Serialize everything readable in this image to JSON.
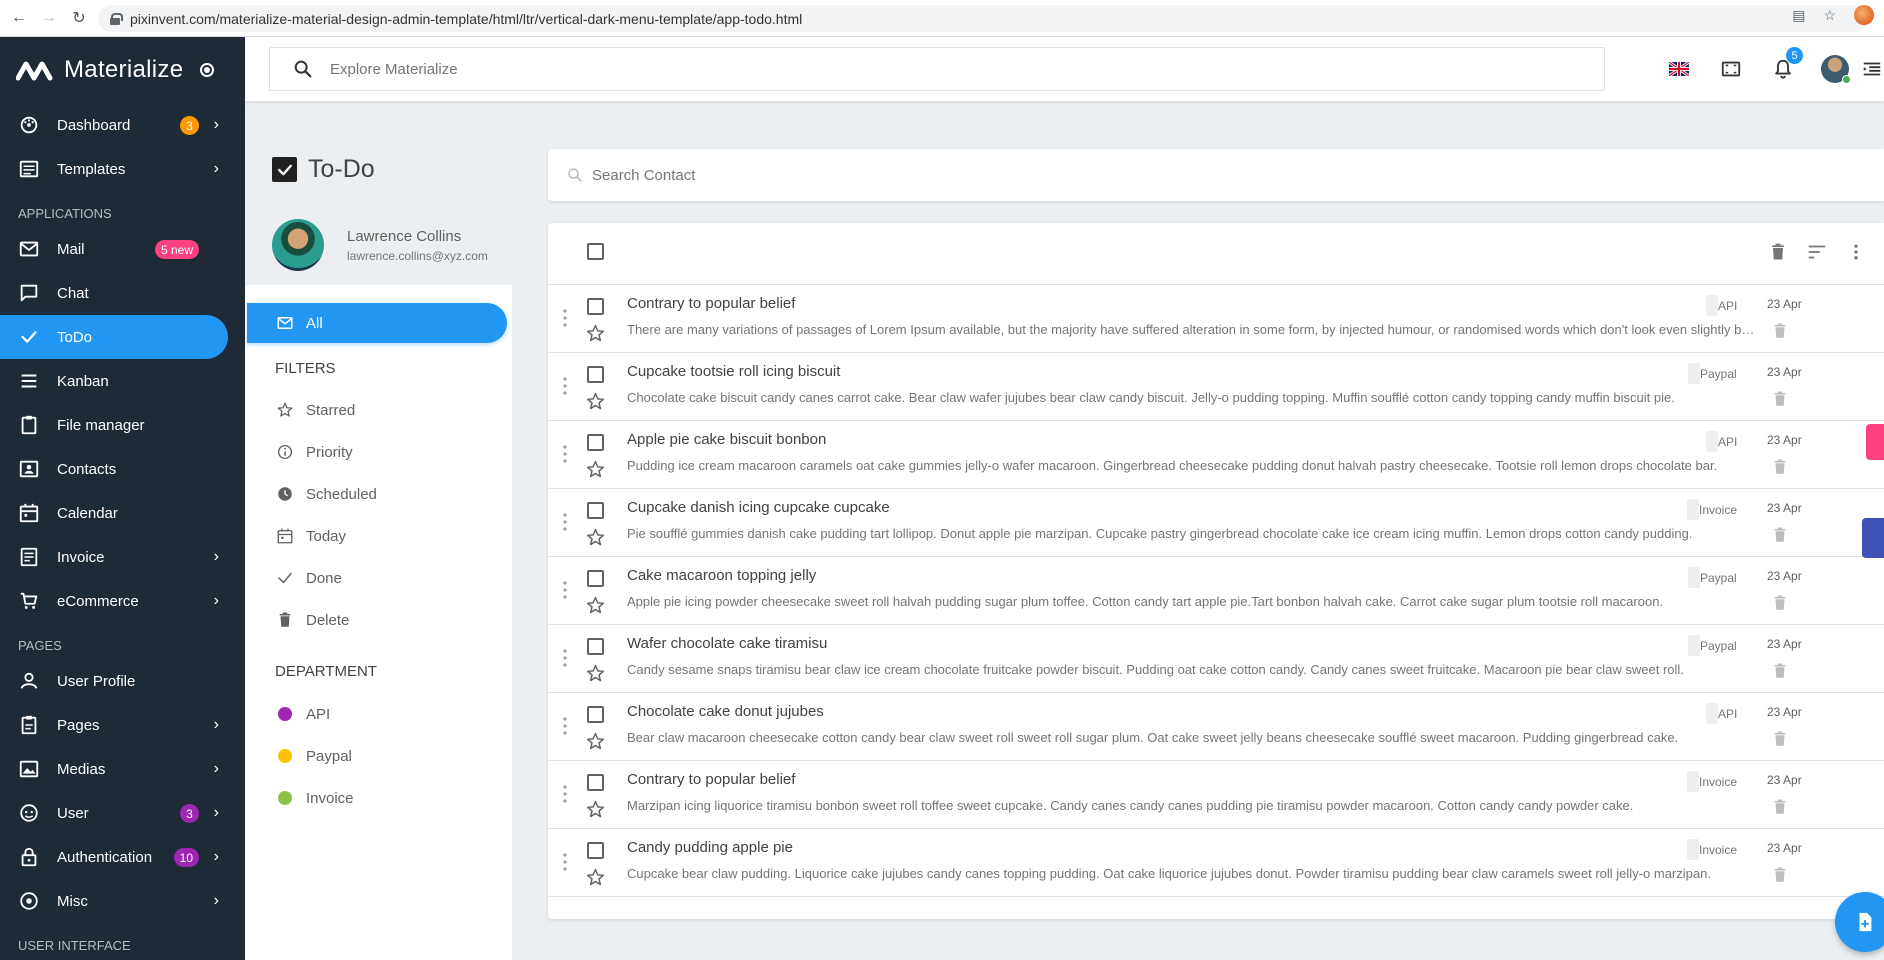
{
  "browser": {
    "url": "pixinvent.com/materialize-material-design-admin-template/html/ltr/vertical-dark-menu-template/app-todo.html"
  },
  "sidebar": {
    "brand": "Materialize",
    "items": [
      {
        "label": "Dashboard",
        "badge": "3",
        "badge_color": "#ff9800",
        "icon": "dashboard-icon",
        "chevron": true
      },
      {
        "label": "Templates",
        "icon": "templates-icon",
        "chevron": true
      }
    ],
    "applications_heading": "APPLICATIONS",
    "apps": [
      {
        "label": "Mail",
        "badge": "5 new",
        "badge_color": "#ff4081",
        "icon": "mail-icon"
      },
      {
        "label": "Chat",
        "icon": "chat-icon"
      },
      {
        "label": "ToDo",
        "icon": "check-icon",
        "active": true
      },
      {
        "label": "Kanban",
        "icon": "kanban-icon"
      },
      {
        "label": "File manager",
        "icon": "file-manager-icon"
      },
      {
        "label": "Contacts",
        "icon": "contacts-icon"
      },
      {
        "label": "Calendar",
        "icon": "calendar-icon"
      },
      {
        "label": "Invoice",
        "icon": "invoice-icon",
        "chevron": true
      },
      {
        "label": "eCommerce",
        "icon": "cart-icon",
        "chevron": true
      }
    ],
    "pages_heading": "PAGES",
    "pages": [
      {
        "label": "User Profile",
        "icon": "user-icon"
      },
      {
        "label": "Pages",
        "icon": "pages-icon",
        "chevron": true
      },
      {
        "label": "Medias",
        "icon": "media-icon",
        "chevron": true
      },
      {
        "label": "User",
        "badge": "3",
        "badge_color": "#9c27b0",
        "icon": "face-icon",
        "chevron": true
      },
      {
        "label": "Authentication",
        "badge": "10",
        "badge_color": "#9c27b0",
        "icon": "lock-icon",
        "chevron": true
      },
      {
        "label": "Misc",
        "icon": "misc-icon",
        "chevron": true
      }
    ],
    "ui_heading": "USER INTERFACE"
  },
  "topbar": {
    "search_placeholder": "Explore Materialize",
    "notifications_count": "5"
  },
  "todo": {
    "title": "To-Do",
    "user_name": "Lawrence Collins",
    "user_email": "lawrence.collins@xyz.com",
    "all_label": "All",
    "filters_heading": "FILTERS",
    "filters": [
      {
        "label": "Starred",
        "icon": "star-icon"
      },
      {
        "label": "Priority",
        "icon": "info-icon"
      },
      {
        "label": "Scheduled",
        "icon": "clock-icon"
      },
      {
        "label": "Today",
        "icon": "calendar-icon"
      },
      {
        "label": "Done",
        "icon": "check-icon"
      },
      {
        "label": "Delete",
        "icon": "trash-icon"
      }
    ],
    "department_heading": "DEPARTMENT",
    "departments": [
      {
        "label": "API",
        "color": "#9c27b0"
      },
      {
        "label": "Paypal",
        "color": "#ffc107"
      },
      {
        "label": "Invoice",
        "color": "#8bc34a"
      }
    ],
    "search_placeholder": "Search Contact",
    "tasks": [
      {
        "title": "Contrary to popular belief",
        "desc": "There are many variations of passages of Lorem Ipsum available, but the majority have suffered alteration in some form, by injected humour, or randomised words which don't look even slightly believable.",
        "tag": "API",
        "tag_color": "#9c27b0",
        "date": "23 Apr"
      },
      {
        "title": "Cupcake tootsie roll icing biscuit",
        "desc": "Chocolate cake biscuit candy canes carrot cake. Bear claw wafer jujubes bear claw candy biscuit. Jelly-o pudding topping. Muffin soufflé cotton candy topping candy muffin biscuit pie.",
        "tag": "Paypal",
        "tag_color": "#ffc107",
        "date": "23 Apr"
      },
      {
        "title": "Apple pie cake biscuit bonbon",
        "desc": "Pudding ice cream macaroon caramels oat cake gummies jelly-o wafer macaroon. Gingerbread cheesecake pudding donut halvah pastry cheesecake. Tootsie roll lemon drops chocolate bar.",
        "tag": "API",
        "tag_color": "#9c27b0",
        "date": "23 Apr"
      },
      {
        "title": "Cupcake danish icing cupcake cupcake",
        "desc": "Pie soufflé gummies danish cake pudding tart lollipop. Donut apple pie marzipan. Cupcake pastry gingerbread chocolate cake ice cream icing muffin. Lemon drops cotton candy pudding.",
        "tag": "Invoice",
        "tag_color": "#8bc34a",
        "date": "23 Apr"
      },
      {
        "title": "Cake macaroon topping jelly",
        "desc": "Apple pie icing powder cheesecake sweet roll halvah pudding sugar plum toffee. Cotton candy tart apple pie.Tart bonbon halvah cake. Carrot cake sugar plum tootsie roll macaroon.",
        "tag": "Paypal",
        "tag_color": "#ffc107",
        "date": "23 Apr"
      },
      {
        "title": "Wafer chocolate cake tiramisu",
        "desc": "Candy sesame snaps tiramisu bear claw ice cream chocolate fruitcake powder biscuit. Pudding oat cake cotton candy. Candy canes sweet fruitcake. Macaroon pie bear claw sweet roll.",
        "tag": "Paypal",
        "tag_color": "#ffc107",
        "date": "23 Apr"
      },
      {
        "title": "Chocolate cake donut jujubes",
        "desc": "Bear claw macaroon cheesecake cotton candy bear claw sweet roll sweet roll sugar plum. Oat cake sweet jelly beans cheesecake soufflé sweet macaroon. Pudding gingerbread cake.",
        "tag": "API",
        "tag_color": "#9c27b0",
        "date": "23 Apr"
      },
      {
        "title": "Contrary to popular belief",
        "desc": "Marzipan icing liquorice tiramisu bonbon sweet roll toffee sweet cupcake. Candy canes candy canes pudding pie tiramisu powder macaroon. Cotton candy candy powder cake.",
        "tag": "Invoice",
        "tag_color": "#8bc34a",
        "date": "23 Apr"
      },
      {
        "title": "Candy pudding apple pie",
        "desc": "Cupcake bear claw pudding. Liquorice cake jujubes candy canes topping pudding. Oat cake liquorice jujubes donut. Powder tiramisu pudding bear claw caramels sweet roll jelly-o marzipan.",
        "tag": "Invoice",
        "tag_color": "#8bc34a",
        "date": "23 Apr"
      }
    ]
  }
}
